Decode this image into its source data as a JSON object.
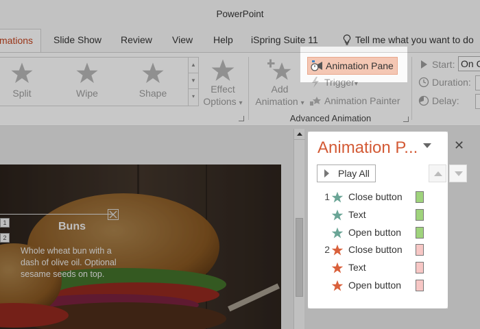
{
  "window": {
    "title": "PowerPoint"
  },
  "tabs": [
    {
      "label": "Animations",
      "visible_text": "mations",
      "active": true
    },
    {
      "label": "Slide Show"
    },
    {
      "label": "Review"
    },
    {
      "label": "View"
    },
    {
      "label": "Help"
    },
    {
      "label": "iSpring Suite 11"
    }
  ],
  "tell_me": {
    "label": "Tell me what you want to do",
    "icon": "lightbulb-icon"
  },
  "ribbon": {
    "gallery": [
      {
        "label": "Split",
        "icon": "star-icon"
      },
      {
        "label": "Wipe",
        "icon": "star-icon"
      },
      {
        "label": "Shape",
        "icon": "star-icon"
      }
    ],
    "effect_options": {
      "line1": "Effect",
      "line2": "Options",
      "caret": "▾"
    },
    "add_animation": {
      "line1": "Add",
      "line2": "Animation",
      "caret": "▾"
    },
    "animation_pane_button": {
      "label": "Animation Pane",
      "icon": "animation-pane-icon"
    },
    "trigger": {
      "label": "Trigger",
      "caret": "▾"
    },
    "animation_painter": {
      "label": "Animation Painter"
    },
    "group_label": "Advanced Animation",
    "timing": {
      "start_label": "Start:",
      "start_value": "On Click",
      "start_visible": "On C",
      "duration_label": "Duration:",
      "delay_label": "Delay:"
    }
  },
  "slide": {
    "card_title": "Buns",
    "card_text": "Whole wheat bun with a dash of olive oil. Optional sesame seeds on top.",
    "tags": [
      "1",
      "2"
    ]
  },
  "animation_pane": {
    "title": "Animation P...",
    "play_all": "Play All",
    "close": "✕",
    "items": [
      {
        "num": "1",
        "label": "Close button",
        "effect": "entrance",
        "star_color": "#6aa596",
        "bar_color": "#9fd37c"
      },
      {
        "num": "",
        "label": "Text",
        "effect": "entrance",
        "star_color": "#6aa596",
        "bar_color": "#9fd37c"
      },
      {
        "num": "",
        "label": "Open button",
        "effect": "entrance",
        "star_color": "#6aa596",
        "bar_color": "#9fd37c"
      },
      {
        "num": "2",
        "label": "Close button",
        "effect": "exit",
        "star_color": "#d9603b",
        "bar_color": "#f7c7c5"
      },
      {
        "num": "",
        "label": "Text",
        "effect": "exit",
        "star_color": "#d9603b",
        "bar_color": "#f7c7c5"
      },
      {
        "num": "",
        "label": "Open button",
        "effect": "exit",
        "star_color": "#d9603b",
        "bar_color": "#f7c7c5"
      }
    ]
  },
  "colors": {
    "accent": "#d35a35",
    "highlight": "#f4c7b4",
    "entrance": "#6aa596",
    "exit": "#d9603b"
  }
}
